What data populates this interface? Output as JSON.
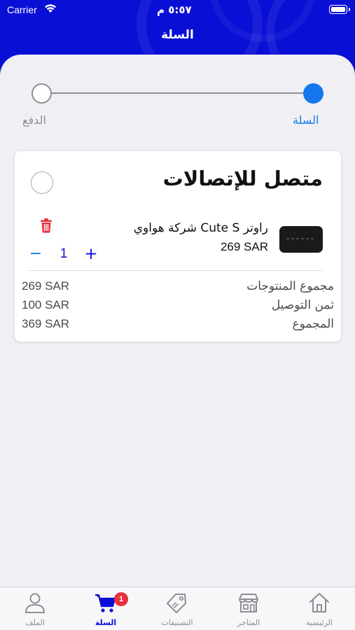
{
  "status_bar": {
    "carrier": "Carrier",
    "time": "٥:٥٧ م"
  },
  "header": {
    "title": "السلة"
  },
  "stepper": {
    "steps": [
      {
        "label": "السلة",
        "active": true
      },
      {
        "label": "الدفع",
        "active": false
      }
    ]
  },
  "store": {
    "name": "متصل للإتصالات",
    "selected": false
  },
  "product": {
    "name": "راوتر Cute S شركة هواوي",
    "price": "269 SAR",
    "quantity": "1",
    "minus_symbol": "−",
    "plus_symbol": "+"
  },
  "summary": {
    "items": [
      {
        "label": "مجموع المنتوجات",
        "value": "269 SAR"
      },
      {
        "label": "ثمن التوصيل",
        "value": "100 SAR"
      },
      {
        "label": "المجموع",
        "value": "369 SAR"
      }
    ]
  },
  "tabbar": {
    "items": [
      {
        "label": "الرئيسية",
        "icon": "home-icon",
        "active": false
      },
      {
        "label": "المتاجر",
        "icon": "store-icon",
        "active": false
      },
      {
        "label": "التصنيفات",
        "icon": "tag-icon",
        "active": false
      },
      {
        "label": "السلة",
        "icon": "cart-icon",
        "active": true,
        "badge": "1"
      },
      {
        "label": "الملف",
        "icon": "profile-icon",
        "active": false
      }
    ]
  },
  "colors": {
    "header_blue": "#0a0fd6",
    "accent_blue": "#1577ee",
    "badge_red": "#e8313b",
    "trash_red": "#e8313b"
  }
}
